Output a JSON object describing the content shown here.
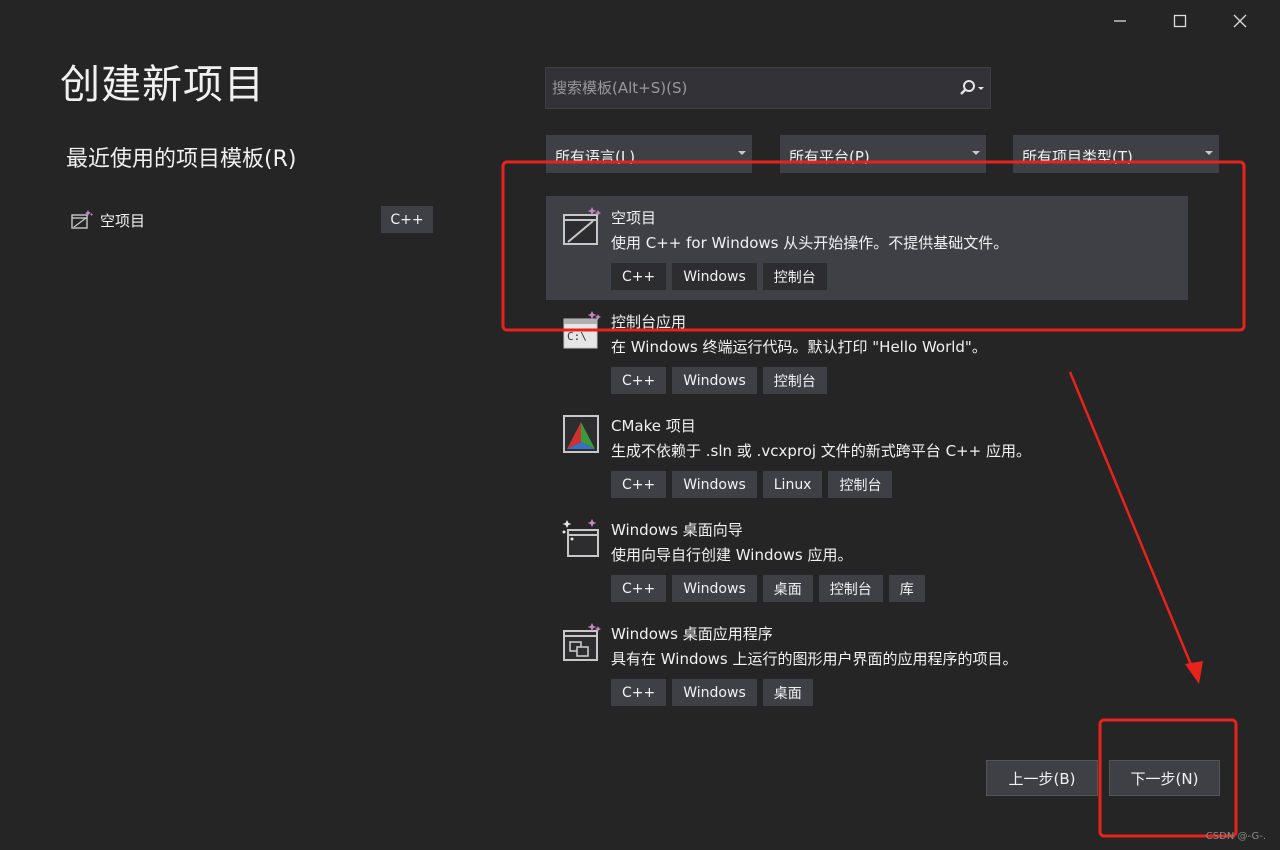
{
  "window": {
    "minimize_icon": "minimize-icon",
    "maximize_icon": "maximize-icon",
    "close_icon": "close-icon"
  },
  "page_title": "创建新项目",
  "recent": {
    "title": "最近使用的项目模板(R)",
    "items": [
      {
        "label": "空项目",
        "lang": "C++",
        "icon": "empty-project-icon"
      }
    ]
  },
  "search": {
    "placeholder": "搜索模板(Alt+S)(S)",
    "value": "",
    "icon": "search-icon"
  },
  "filters": {
    "language": "所有语言(L)",
    "platform": "所有平台(P)",
    "project_type": "所有项目类型(T)"
  },
  "templates": [
    {
      "name": "空项目",
      "desc": "使用 C++ for Windows 从头开始操作。不提供基础文件。",
      "tags": [
        "C++",
        "Windows",
        "控制台"
      ],
      "icon": "empty-project-icon",
      "selected": true
    },
    {
      "name": "控制台应用",
      "desc": "在 Windows 终端运行代码。默认打印 \"Hello World\"。",
      "tags": [
        "C++",
        "Windows",
        "控制台"
      ],
      "icon": "console-app-icon"
    },
    {
      "name": "CMake 项目",
      "desc": "生成不依赖于 .sln 或 .vcxproj 文件的新式跨平台 C++ 应用。",
      "tags": [
        "C++",
        "Windows",
        "Linux",
        "控制台"
      ],
      "icon": "cmake-icon"
    },
    {
      "name": "Windows 桌面向导",
      "desc": "使用向导自行创建 Windows 应用。",
      "tags": [
        "C++",
        "Windows",
        "桌面",
        "控制台",
        "库"
      ],
      "icon": "desktop-wizard-icon"
    },
    {
      "name": "Windows 桌面应用程序",
      "desc": "具有在 Windows 上运行的图形用户界面的应用程序的项目。",
      "tags": [
        "C++",
        "Windows",
        "桌面"
      ],
      "icon": "desktop-app-icon"
    }
  ],
  "buttons": {
    "back": "上一步(B)",
    "next": "下一步(N)"
  },
  "watermark": "CSDN @-G-.",
  "colors": {
    "background": "#252526",
    "selected_row": "#3f3f46",
    "tag": "#3f3f46",
    "annotation": "#e8231c"
  }
}
